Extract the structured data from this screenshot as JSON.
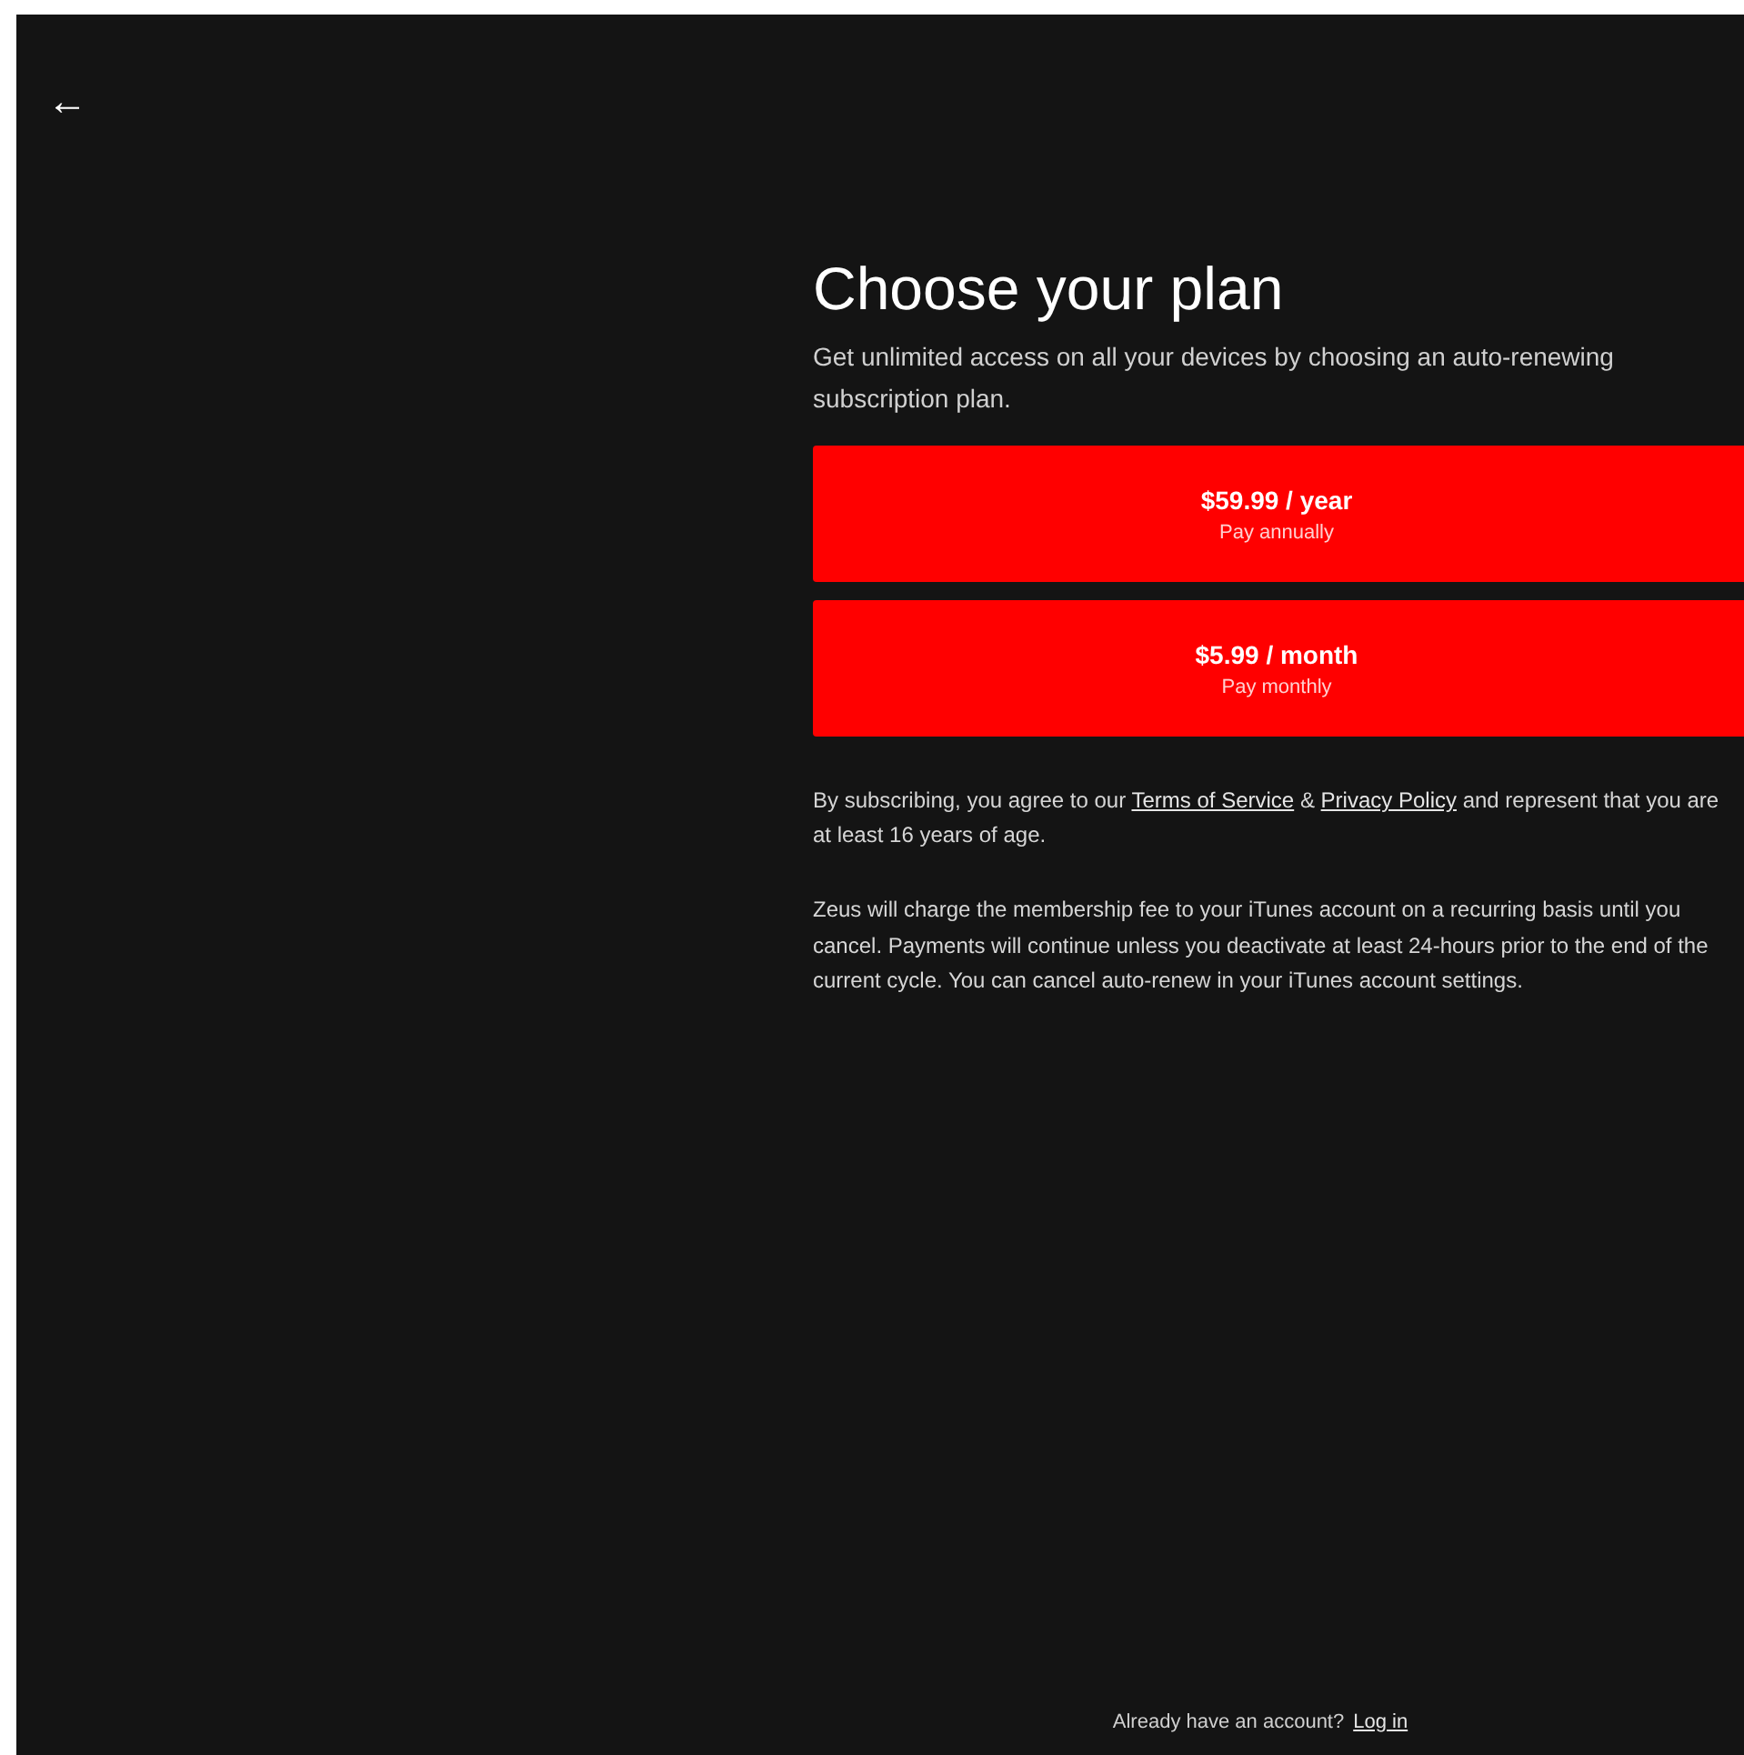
{
  "back_button": {
    "label": "←"
  },
  "title": "Choose your plan",
  "subtitle": "Get unlimited access on all your devices by choosing an auto-renewing subscription plan.",
  "plans": [
    {
      "price": "$59.99 / year",
      "caption": "Pay annually"
    },
    {
      "price": "$5.99 / month",
      "caption": "Pay monthly"
    }
  ],
  "legal": {
    "text_before": "By subscribing, you agree to our",
    "terms_link": "Terms of Service",
    "joiner": "&",
    "privacy_link": "Privacy Policy",
    "text_after": "and represent that you are at least 16 years of age."
  },
  "billing_note": "Zeus will charge the membership fee to your iTunes account on a recurring basis until you cancel. Payments will continue unless you deactivate at least 24-hours prior to the end of the current cycle. You can cancel auto-renew in your iTunes account settings.",
  "footer": {
    "prompt": "Already have an account?",
    "login_link": "Log in"
  }
}
